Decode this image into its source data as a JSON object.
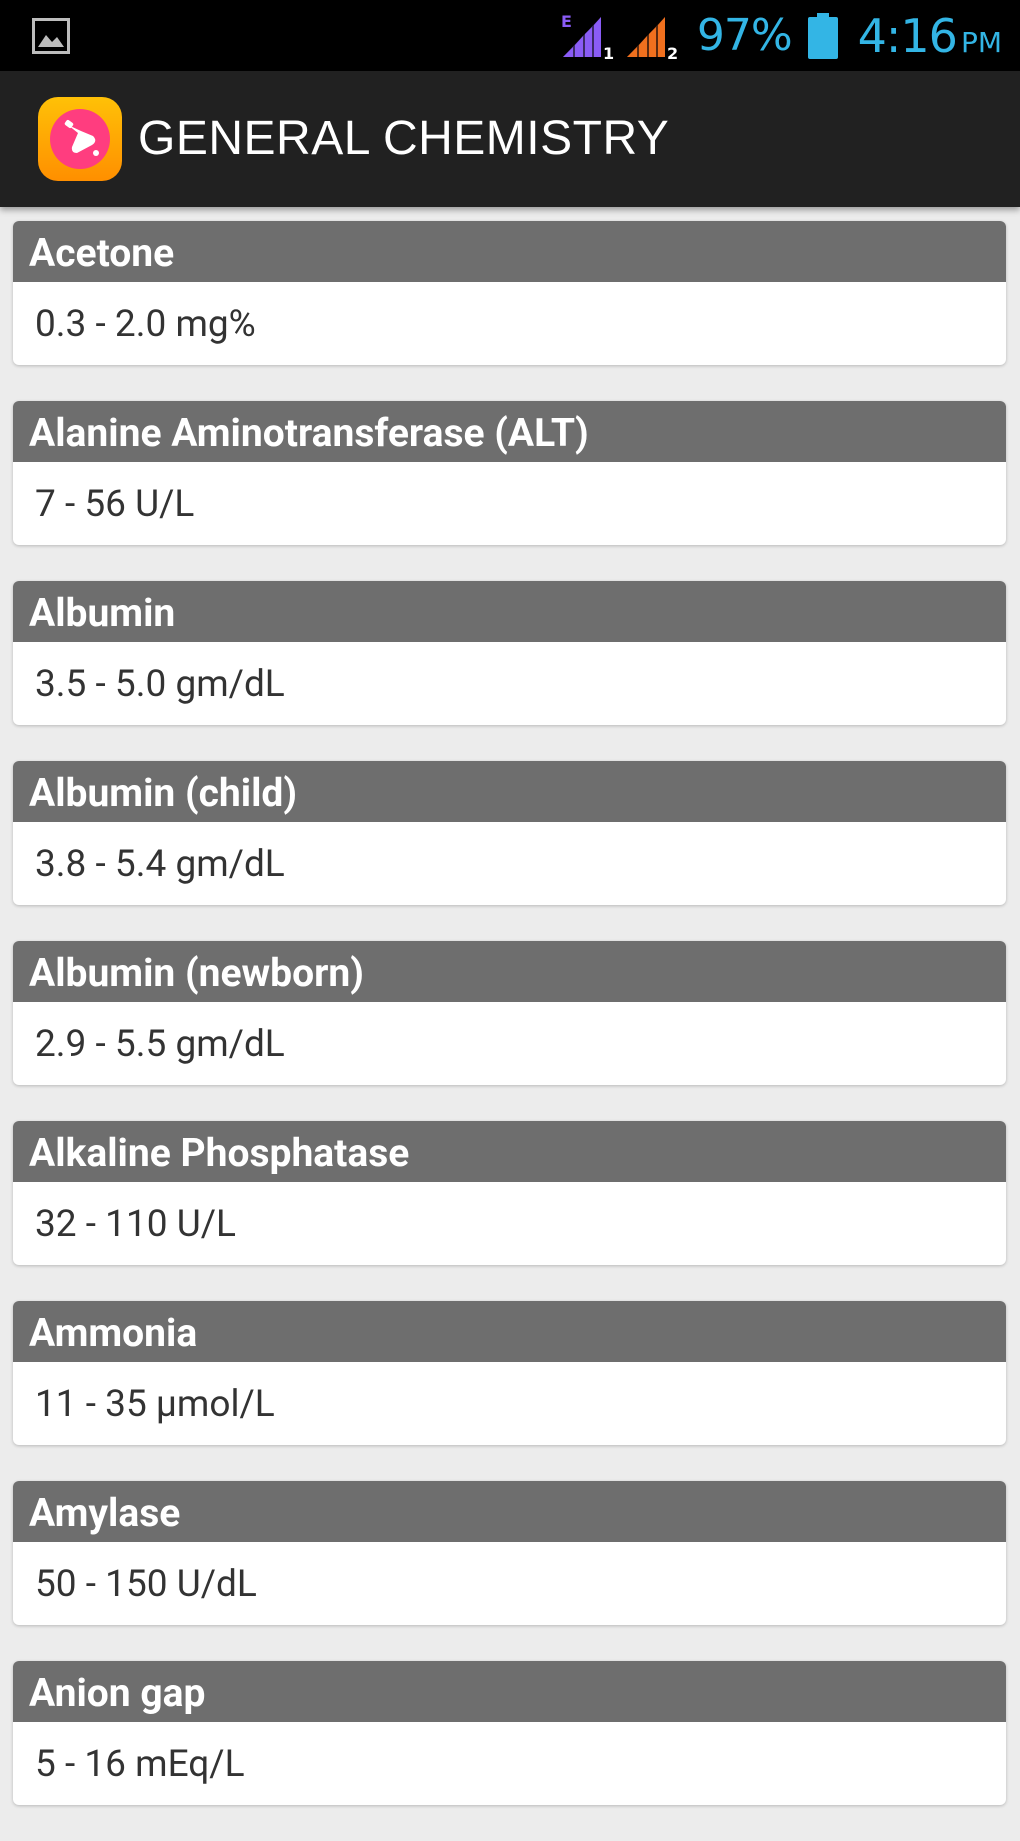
{
  "status_bar": {
    "notification_icon": "image-icon",
    "network_type": "E",
    "sim1_label": "1",
    "sim2_label": "2",
    "battery_percent": "97%",
    "time": "4:16",
    "ampm": "PM",
    "colors": {
      "background": "#000000",
      "accent": "#33b5e5",
      "sim1_signal": "#8a5cf6",
      "sim2_signal": "#f0701e"
    }
  },
  "action_bar": {
    "title": "GENERAL CHEMISTRY",
    "logo_icon": "flask-icon",
    "colors": {
      "background": "#212121",
      "logo_gradient_start": "#ffb300",
      "logo_gradient_end": "#ff7a00",
      "logo_circle": "#ff3d7f"
    }
  },
  "items": [
    {
      "name": "Acetone",
      "range": "0.3 - 2.0 mg%"
    },
    {
      "name": "Alanine Aminotransferase (ALT)",
      "range": "7 - 56 U/L"
    },
    {
      "name": "Albumin",
      "range": "3.5 - 5.0 gm/dL"
    },
    {
      "name": "Albumin (child)",
      "range": "3.8 - 5.4 gm/dL"
    },
    {
      "name": "Albumin (newborn)",
      "range": "2.9 - 5.5 gm/dL"
    },
    {
      "name": "Alkaline Phosphatase",
      "range": "32 - 110 U/L"
    },
    {
      "name": "Ammonia",
      "range": "11 - 35 µmol/L"
    },
    {
      "name": "Amylase",
      "range": "50 - 150 U/dL"
    },
    {
      "name": "Anion gap",
      "range": "5 - 16 mEq/L"
    }
  ],
  "colors": {
    "page_background": "#ececec",
    "card_header": "#6e6e6e",
    "card_body": "#ffffff",
    "header_text": "#ffffff",
    "body_text": "#333333"
  }
}
